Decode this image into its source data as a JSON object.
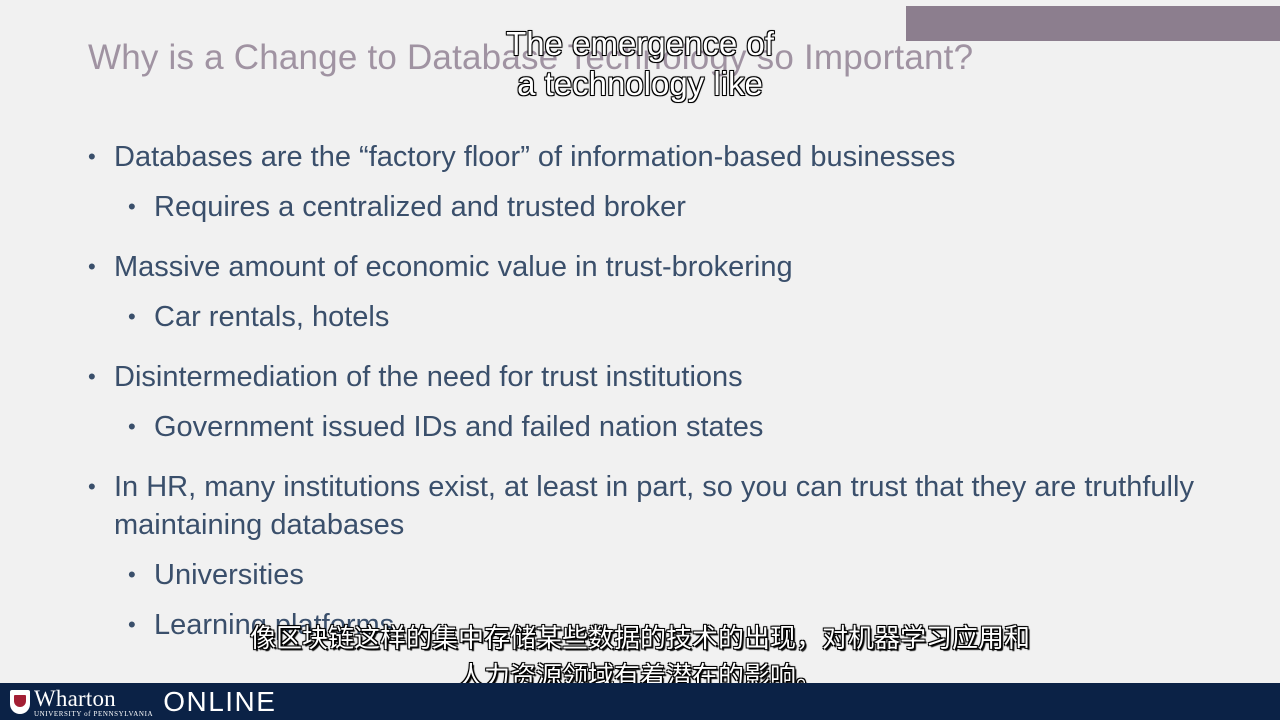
{
  "slide": {
    "title": "Why is a Change to Database Technology so Important?",
    "bullets": [
      {
        "level": 1,
        "text": "Databases are the “factory floor” of information-based businesses"
      },
      {
        "level": 2,
        "text": "Requires a centralized and trusted broker"
      },
      {
        "level": 1,
        "text": "Massive amount of economic value in trust-brokering"
      },
      {
        "level": 2,
        "text": "Car rentals, hotels"
      },
      {
        "level": 1,
        "text": "Disintermediation of the need for trust institutions"
      },
      {
        "level": 2,
        "text": "Government issued IDs and failed nation states"
      },
      {
        "level": 1,
        "text": "In HR, many institutions exist, at least in part, so you can trust that they are truthfully maintaining databases"
      },
      {
        "level": 2,
        "text": "Universities"
      },
      {
        "level": 2,
        "text": "Learning platforms"
      }
    ]
  },
  "captions": {
    "english_line1": "The emergence of",
    "english_line2": "a technology like",
    "chinese_line1": "像区块链这样的集中存储某些数据的技术的出现，对机器学习应用和",
    "chinese_line2": "人力资源领域有着潜在的影响。"
  },
  "footer": {
    "logo_word": "Wharton",
    "logo_sub": "UNIVERSITY of PENNSYLVANIA",
    "logo_online": "ONLINE"
  },
  "colors": {
    "background": "#f1f1f1",
    "title": "#a093a2",
    "body_text": "#3a4f6b",
    "corner_box": "#8c7e8e",
    "footer_bar": "#0b2246"
  }
}
